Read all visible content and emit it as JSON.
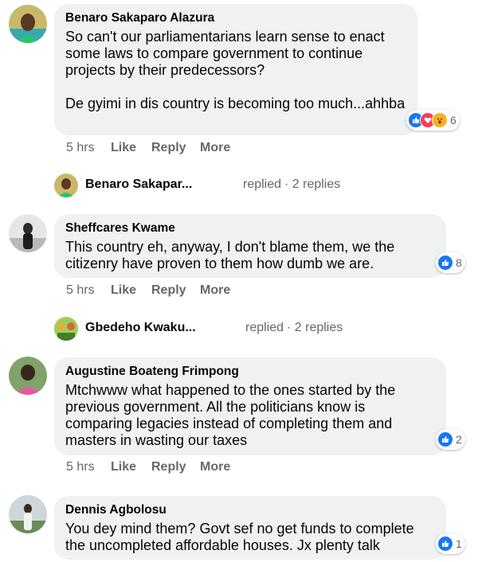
{
  "comments": [
    {
      "author": "Benaro Sakaparo Alazura",
      "text": "So can't our parliamentarians learn sense to enact some laws to compare government to continue projects by their predecessors?\n\nDe gyimi in dis country is becoming too much...ahhba",
      "time": "5 hrs",
      "like": "Like",
      "reply": "Reply",
      "more": "More",
      "reactions": [
        "like-icon",
        "love-icon",
        "wow-icon"
      ],
      "reaction_count": "6",
      "replies": {
        "name": "Benaro Sakapar...",
        "verb": "replied",
        "count": "· 2 replies"
      }
    },
    {
      "author": "Sheffcares Kwame",
      "text": "This country eh, anyway, I don't blame them, we the citizenry have proven to them how dumb we are.",
      "time": "5 hrs",
      "like": "Like",
      "reply": "Reply",
      "more": "More",
      "reactions": [
        "like-icon"
      ],
      "reaction_count": "8",
      "replies": {
        "name": "Gbedeho Kwaku...",
        "verb": "replied",
        "count": "· 2 replies"
      }
    },
    {
      "author": "Augustine Boateng Frimpong",
      "text": "Mtchwww what happened to the ones started by the previous government. All the politicians know is comparing legacies instead of completing them and masters in wasting our taxes",
      "time": "5 hrs",
      "like": "Like",
      "reply": "Reply",
      "more": "More",
      "reactions": [
        "like-icon"
      ],
      "reaction_count": "2"
    },
    {
      "author": "Dennis Agbolosu",
      "text": "You dey mind them? Govt sef no get funds to complete the uncompleted affordable houses. Jx plenty talk",
      "reactions": [
        "like-icon"
      ],
      "reaction_count": "1"
    }
  ],
  "colors": {
    "like": "#1877f2",
    "love": "#f33e58",
    "wow": "#f7b125",
    "bubble": "#eff1f3",
    "meta": "#65676b"
  }
}
